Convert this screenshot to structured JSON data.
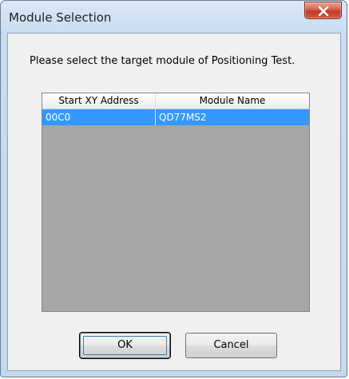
{
  "window": {
    "title": "Module Selection"
  },
  "dialog": {
    "prompt": "Please select the target module of Positioning Test.",
    "columns": [
      "Start XY Address",
      "Module Name"
    ],
    "rows": [
      {
        "address": "00C0",
        "module": "QD77MS2",
        "selected": true
      }
    ],
    "ok_label": "OK",
    "cancel_label": "Cancel"
  },
  "colors": {
    "selection": "#3399ff",
    "list_background": "#a6a6a6"
  }
}
